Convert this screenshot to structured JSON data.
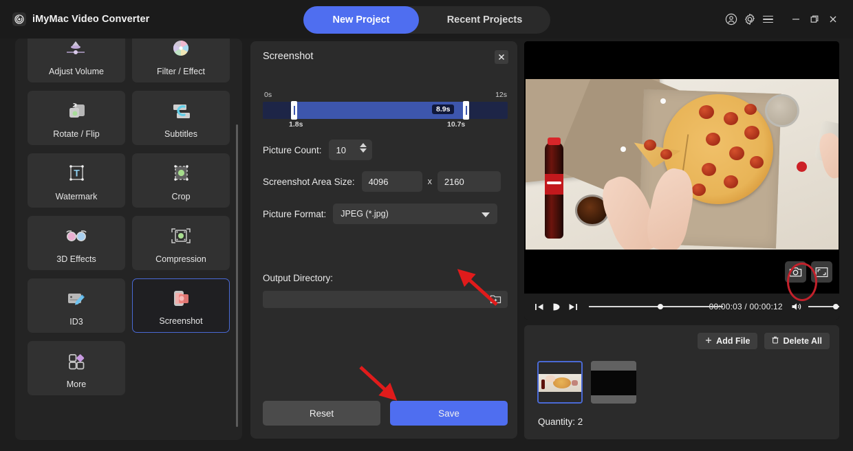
{
  "app": {
    "title": "iMyMac Video Converter",
    "logo_icon": "disc-logo-icon"
  },
  "header": {
    "tabs": [
      {
        "label": "New Project",
        "active": true
      },
      {
        "label": "Recent Projects",
        "active": false
      }
    ],
    "icons": [
      {
        "name": "account-icon",
        "label": "Account"
      },
      {
        "name": "gear-icon",
        "label": "Settings"
      },
      {
        "name": "menu-icon",
        "label": "Menu"
      }
    ],
    "window_controls": [
      {
        "name": "minimize-button",
        "label": "Minimize"
      },
      {
        "name": "maximize-button",
        "label": "Restore"
      },
      {
        "name": "close-button",
        "label": "Close"
      }
    ]
  },
  "tools": {
    "items": [
      {
        "label": "Adjust Volume",
        "icon": "volume-slider-icon",
        "selected": false
      },
      {
        "label": "Filter / Effect",
        "icon": "color-wheel-icon",
        "selected": false
      },
      {
        "label": "Rotate / Flip",
        "icon": "rotate-flip-icon",
        "selected": false
      },
      {
        "label": "Subtitles",
        "icon": "subtitles-icon",
        "selected": false
      },
      {
        "label": "Watermark",
        "icon": "watermark-text-icon",
        "selected": false
      },
      {
        "label": "Crop",
        "icon": "crop-icon",
        "selected": false
      },
      {
        "label": "3D Effects",
        "icon": "3d-glasses-icon",
        "selected": false
      },
      {
        "label": "Compression",
        "icon": "compression-icon",
        "selected": false
      },
      {
        "label": "ID3",
        "icon": "id3-edit-icon",
        "selected": false
      },
      {
        "label": "Screenshot",
        "icon": "screenshot-icon",
        "selected": true
      },
      {
        "label": "More",
        "icon": "more-grid-icon",
        "selected": false
      }
    ]
  },
  "screenshot_panel": {
    "title": "Screenshot",
    "close_icon": "close-icon",
    "timeline": {
      "start_label": "0s",
      "end_label": "12s",
      "range_start": "1.8s",
      "range_end": "10.7s",
      "position_label": "8.9s"
    },
    "picture_count": {
      "label": "Picture Count:",
      "value": "10"
    },
    "area_size": {
      "label": "Screenshot Area Size:",
      "width": "4096",
      "separator": "x",
      "height": "2160"
    },
    "picture_format": {
      "label": "Picture Format:",
      "value": "JPEG (*.jpg)"
    },
    "output_directory": {
      "label": "Output Directory:",
      "value": "",
      "browse_icon": "folder-add-icon"
    },
    "buttons": {
      "reset": "Reset",
      "save": "Save"
    }
  },
  "preview": {
    "capture_icon": "camera-icon",
    "fullscreen_icon": "expand-icon",
    "controls": {
      "previous_icon": "previous-icon",
      "play_icon": "play-icon",
      "next_icon": "next-icon",
      "time": "00:00:03 / 00:00:12",
      "volume_icon": "volume-icon"
    }
  },
  "file_list": {
    "add_file": {
      "label": "Add File",
      "icon": "plus-icon"
    },
    "delete_all": {
      "label": "Delete All",
      "icon": "trash-icon"
    },
    "quantity": "Quantity: 2",
    "thumbnails": [
      {
        "name": "pizza-clip-thumbnail",
        "selected": true
      },
      {
        "name": "dark-clip-thumbnail",
        "selected": false
      }
    ]
  },
  "annotations": {
    "arrow_to_output_directory": "arrow-pointing-to-output-directory",
    "arrow_to_save_button": "arrow-pointing-to-save-button",
    "highlight_capture_button": "red-ellipse-around-camera-button"
  },
  "colors": {
    "accent": "#4f6ef0",
    "panel": "#2b2b2b",
    "background": "#1d1d1d",
    "annotation_red": "#e01b1b",
    "highlight_ring": "#c2212b",
    "timeline_selection": "#3d56ad"
  }
}
